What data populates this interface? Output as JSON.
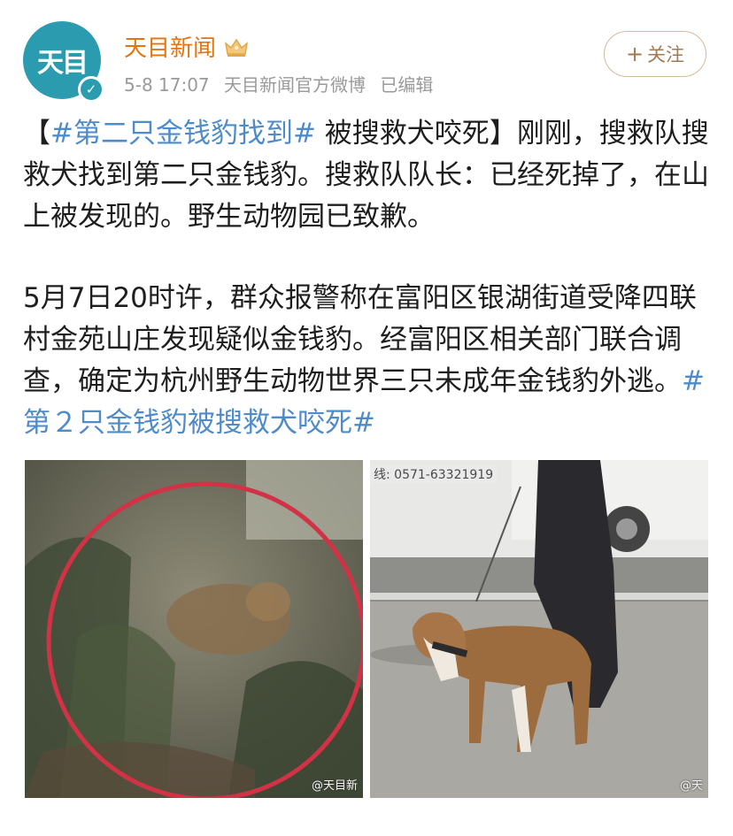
{
  "account": {
    "name": "天目新闻",
    "avatar_text": "天目",
    "post_time": "5-8 17:07",
    "source": "天目新闻官方微博",
    "edited": "已编辑",
    "follow_label": "关注"
  },
  "post": {
    "lead_open": "【",
    "lead_tag": "#第二只金钱豹找到#",
    "lead_title": " 被搜救犬咬死】",
    "lead_text": "刚刚，搜救队搜救犬找到第二只金钱豹。搜救队队长：已经死掉了，在山上被发现的。野生动物园已致歉。",
    "para2_text": "5月7日20时许，群众报警称在富阳区银湖街道受降四联村金苑山庄发现疑似金钱豹。经富阳区相关部门联合调查，确定为杭州野生动物世界三只未成年金钱豹外逃。",
    "para2_tag": "#第２只金钱豹被搜救犬咬死#"
  },
  "images": {
    "left_watermark": "@天目新",
    "right_watermark": "@天",
    "right_sign_text": "线: 0571-63321919"
  },
  "colors": {
    "name": "#e8730a",
    "tag": "#4f8bc9",
    "avatar": "#2b9bb0",
    "follow_border": "#d4b99a",
    "circle": "#d23245"
  }
}
